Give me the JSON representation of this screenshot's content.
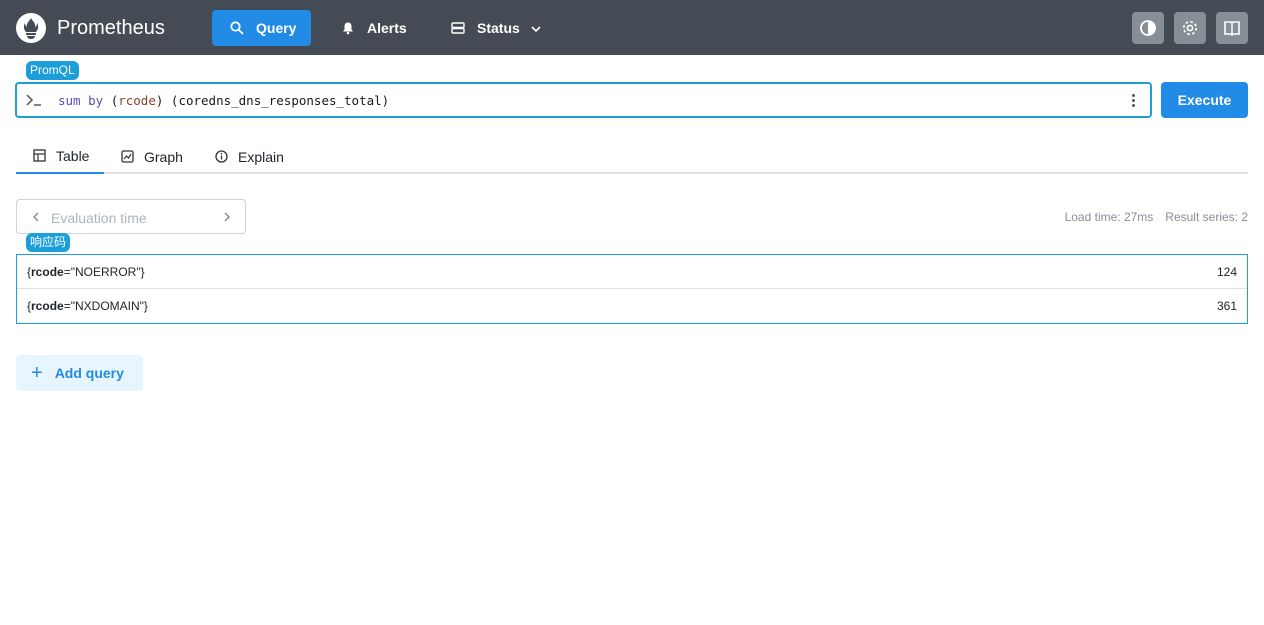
{
  "header": {
    "brand": "Prometheus",
    "nav": {
      "query_label": "Query",
      "alerts_label": "Alerts",
      "status_label": "Status"
    },
    "accent_color": "#228be6",
    "background_color": "#454b54"
  },
  "annotations": {
    "promql_tag": "PromQL",
    "table_tag": "响应码"
  },
  "expression": {
    "tokens": [
      {
        "text": "sum",
        "kind": "kw"
      },
      {
        "text": " ",
        "kind": "plain"
      },
      {
        "text": "by",
        "kind": "kw"
      },
      {
        "text": " (",
        "kind": "plain"
      },
      {
        "text": "rcode",
        "kind": "lbl"
      },
      {
        "text": ") (coredns_dns_responses_total)",
        "kind": "plain"
      }
    ],
    "execute_label": "Execute"
  },
  "tabs": [
    {
      "label": "Table",
      "icon": "table-icon",
      "active": true
    },
    {
      "label": "Graph",
      "icon": "graph-icon",
      "active": false
    },
    {
      "label": "Explain",
      "icon": "info-icon",
      "active": false
    }
  ],
  "eval_time": {
    "placeholder": "Evaluation time"
  },
  "stats": {
    "load_time": "Load time: 27ms",
    "result_series": "Result series: 2"
  },
  "results": [
    {
      "label_name": "rcode",
      "label_value": "NOERROR",
      "value": "124"
    },
    {
      "label_name": "rcode",
      "label_value": "NXDOMAIN",
      "value": "361"
    }
  ],
  "add_query_label": "Add query"
}
